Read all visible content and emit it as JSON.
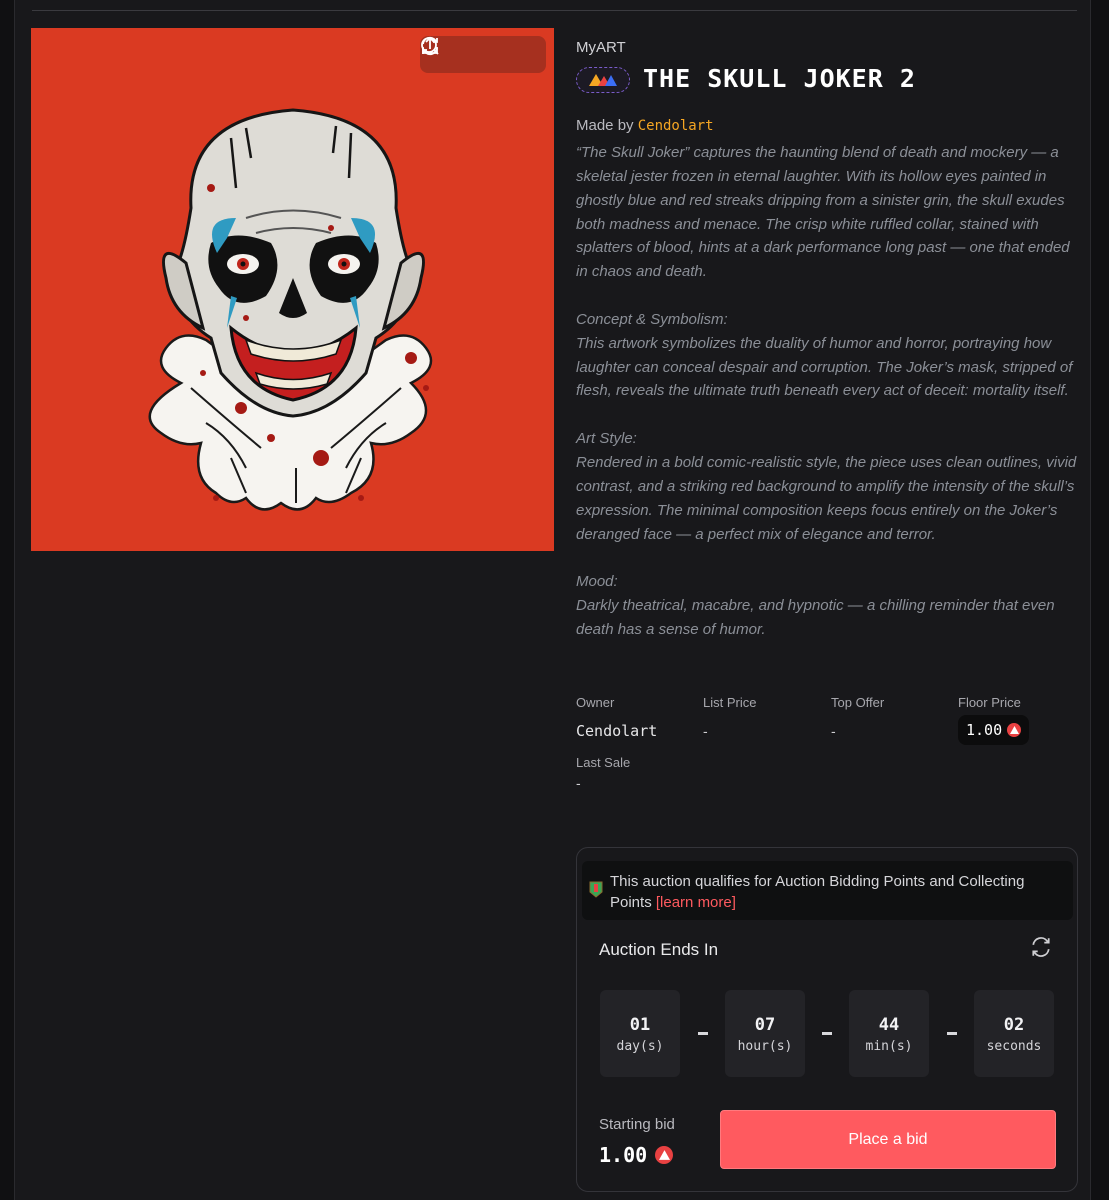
{
  "toolbar": {
    "icons": [
      "refresh-icon",
      "search-icon",
      "share-icon"
    ]
  },
  "nft": {
    "collection": "MyART",
    "title": "THE SKULL JOKER 2",
    "made_by_prefix": "Made by",
    "creator": "Cendolart"
  },
  "description": {
    "intro": "“The Skull Joker” captures the haunting blend of death and mockery — a skeletal jester frozen in eternal laughter. With its hollow eyes painted in ghostly blue and red streaks dripping from a sinister grin, the skull exudes both madness and menace. The crisp white ruffled collar, stained with splatters of blood, hints at a dark performance long past — one that ended in chaos and death.",
    "concept_heading": "Concept & Symbolism:",
    "concept": "This artwork symbolizes the duality of humor and horror, portraying how laughter can conceal despair and corruption. The Joker’s mask, stripped of flesh, reveals the ultimate truth beneath every act of deceit: mortality itself.",
    "style_heading": "Art Style:",
    "style": "Rendered in a bold comic-realistic style, the piece uses clean outlines, vivid contrast, and a striking red background to amplify the intensity of the skull’s expression. The minimal composition keeps focus entirely on the Joker’s deranged face — a perfect mix of elegance and terror.",
    "mood_heading": "Mood:",
    "mood": "Darkly theatrical, macabre, and hypnotic — a chilling reminder that even death has a sense of humor."
  },
  "stats": {
    "owner_label": "Owner",
    "owner": "Cendolart",
    "list_price_label": "List Price",
    "list_price": "-",
    "top_offer_label": "Top Offer",
    "top_offer": "-",
    "floor_price_label": "Floor Price",
    "floor_price": "1.00",
    "last_sale_label": "Last Sale",
    "last_sale": "-"
  },
  "auction": {
    "notice_text": "This auction qualifies for Auction Bidding Points and Collecting Points",
    "notice_link": "[learn more]",
    "ends_label": "Auction Ends In",
    "countdown": [
      {
        "value": "01",
        "unit": "day(s)"
      },
      {
        "value": "07",
        "unit": "hour(s)"
      },
      {
        "value": "44",
        "unit": "min(s)"
      },
      {
        "value": "02",
        "unit": "seconds"
      }
    ],
    "starting_bid_label": "Starting bid",
    "starting_bid": "1.00",
    "bid_button": "Place a bid"
  },
  "colors": {
    "accent": "#ff5a5f",
    "creator": "#f5a623",
    "art_bg": "#da3a22",
    "avax": "#e84142"
  }
}
